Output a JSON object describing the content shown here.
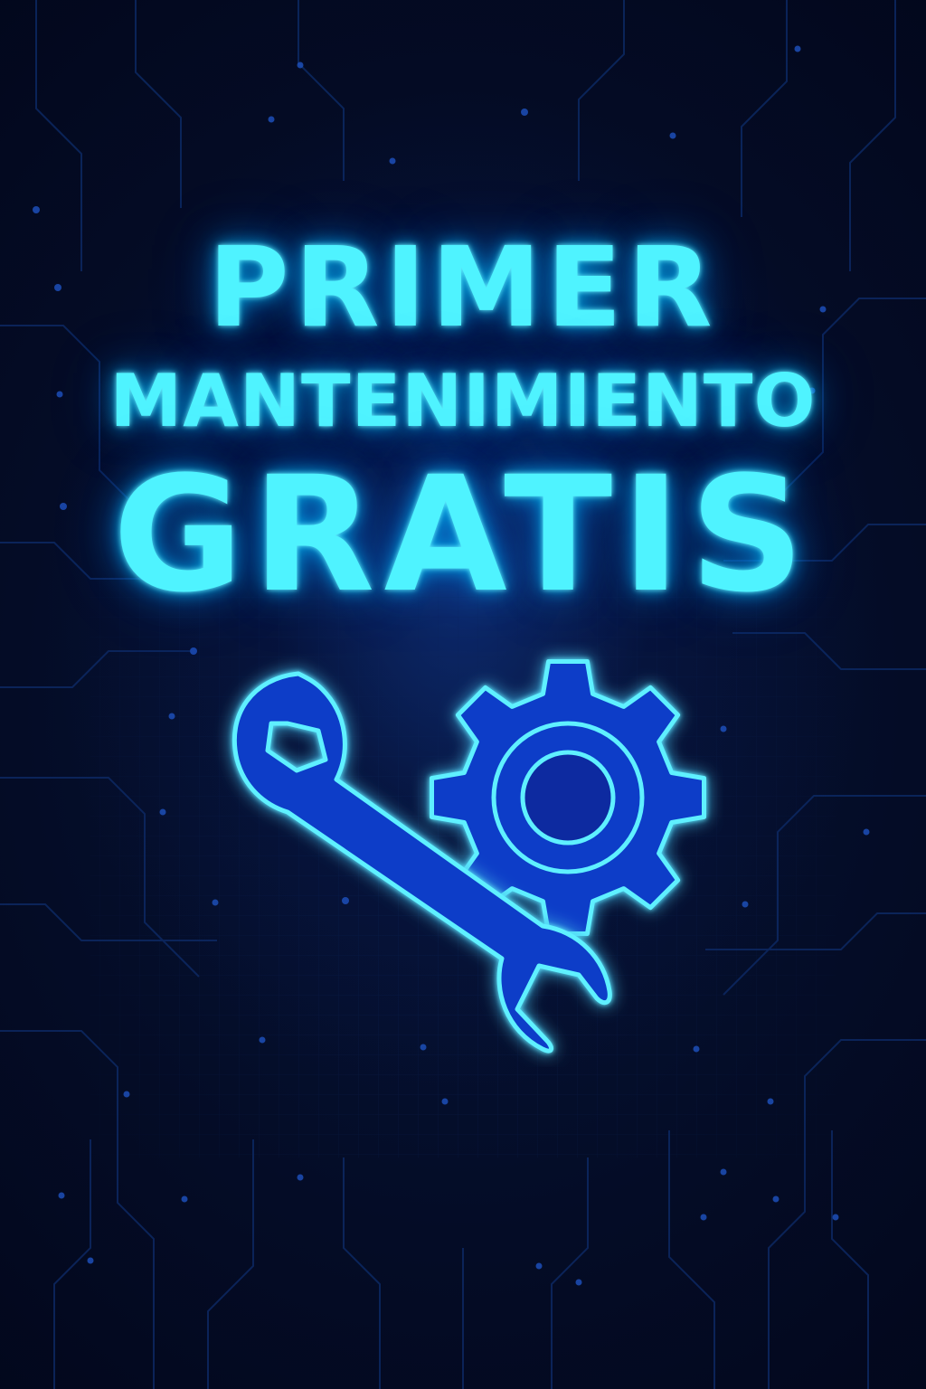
{
  "headline": {
    "line1": "PRIMER",
    "line2": "MANTENIMIENTO",
    "line3": "GRATIS"
  },
  "icon": {
    "name": "wrench-and-gear-icon",
    "components": [
      "wrench-icon",
      "gear-icon"
    ]
  },
  "colors": {
    "background": "#03091c",
    "text_glow": "#4ff3ff",
    "icon_stroke": "#5ef0ff",
    "icon_fill": "#0a3cc8",
    "circuit_lines": "#0d2a66"
  }
}
